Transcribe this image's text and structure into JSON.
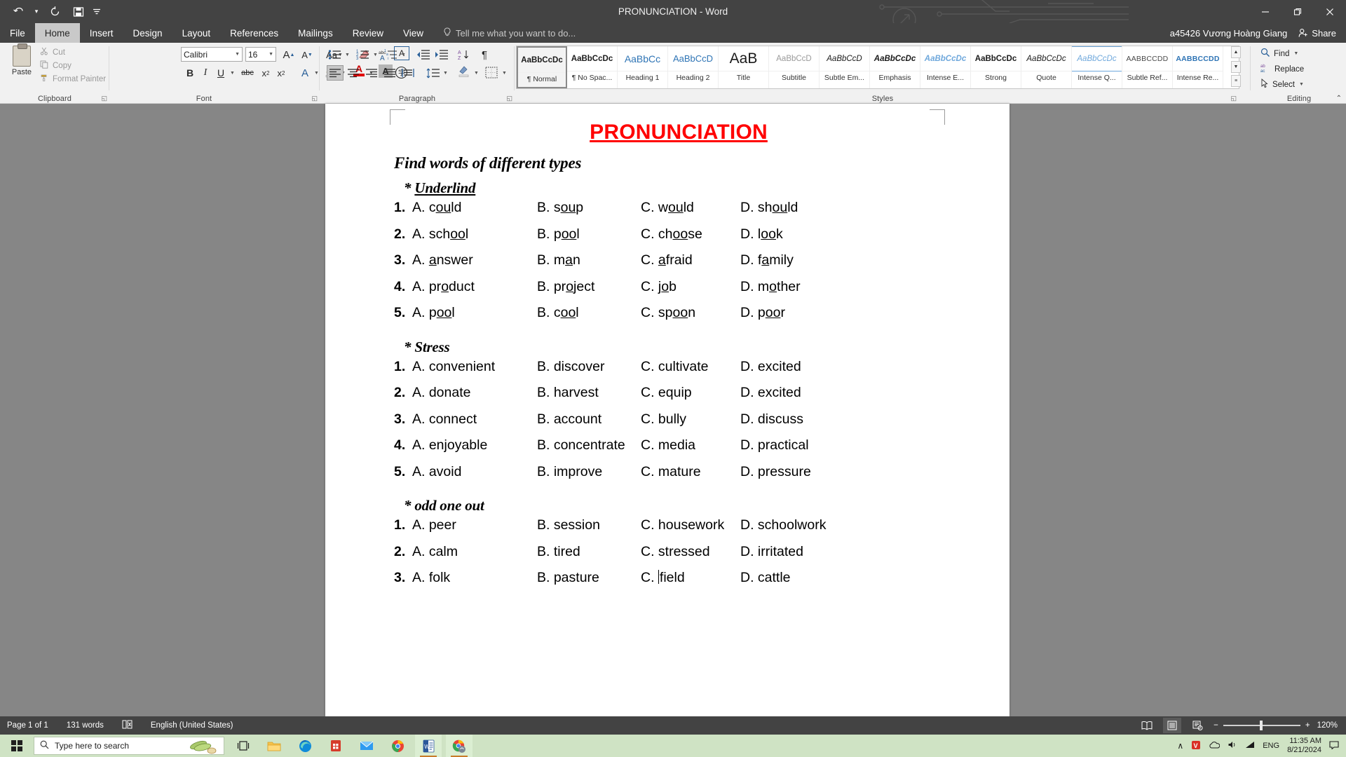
{
  "titlebar": {
    "document_title": "PRONUNCIATION - Word",
    "qat": [
      {
        "name": "undo",
        "glyph": "↶"
      },
      {
        "name": "undo-dropdown",
        "glyph": "▾"
      },
      {
        "name": "redo",
        "glyph": "↻"
      },
      {
        "name": "save",
        "glyph": "὚b"
      },
      {
        "name": "customize-qat",
        "glyph": "≔"
      }
    ],
    "window_buttons": {
      "minimize": "─",
      "restore": "❐",
      "close": "✕"
    }
  },
  "ribbon_tabs": {
    "tabs": [
      "File",
      "Home",
      "Insert",
      "Design",
      "Layout",
      "References",
      "Mailings",
      "Review",
      "View"
    ],
    "active": "Home",
    "tell_me": "Tell me what you want to do...",
    "account_name": "a45426 Vương Hoàng Giang",
    "share_label": "Share"
  },
  "ribbon": {
    "groups": [
      {
        "name": "Clipboard",
        "label": "Clipboard"
      },
      {
        "name": "Font",
        "label": "Font"
      },
      {
        "name": "Paragraph",
        "label": "Paragraph"
      },
      {
        "name": "Styles",
        "label": "Styles"
      },
      {
        "name": "Editing",
        "label": "Editing"
      }
    ],
    "clipboard": {
      "paste_label": "Paste",
      "items": [
        {
          "label": "Cut",
          "icon": "scissors-icon",
          "glyph": "✂"
        },
        {
          "label": "Copy",
          "icon": "copy-icon",
          "glyph": "⧉"
        },
        {
          "label": "Format Painter",
          "icon": "format-painter-icon",
          "glyph": "✒"
        }
      ]
    },
    "font": {
      "font_name": "Calibri",
      "font_size": "16",
      "buttons": [
        {
          "name": "grow-font",
          "glyph": "A"
        },
        {
          "name": "shrink-font",
          "glyph": "A"
        },
        {
          "name": "change-case",
          "glyph": "Aa"
        },
        {
          "name": "clear-formatting",
          "glyph": "⌫"
        },
        {
          "name": "phonetic-guide",
          "glyph": "abc"
        },
        {
          "name": "character-border",
          "glyph": "A"
        },
        {
          "name": "bold",
          "glyph": "B"
        },
        {
          "name": "italic",
          "glyph": "I"
        },
        {
          "name": "underline",
          "glyph": "U"
        },
        {
          "name": "strikethrough",
          "glyph": "abc"
        },
        {
          "name": "subscript",
          "glyph": "x₂"
        },
        {
          "name": "superscript",
          "glyph": "x²"
        },
        {
          "name": "text-effects",
          "glyph": "A"
        },
        {
          "name": "text-highlight-color",
          "glyph": "✐"
        },
        {
          "name": "font-color",
          "glyph": "A"
        },
        {
          "name": "character-shading",
          "glyph": "A"
        },
        {
          "name": "enclose-characters",
          "glyph": "Ⓢ"
        }
      ]
    },
    "paragraph": {
      "buttons": [
        {
          "name": "bullets",
          "glyph": "≣"
        },
        {
          "name": "numbering",
          "glyph": "≣"
        },
        {
          "name": "multilevel-list",
          "glyph": "≣"
        },
        {
          "name": "decrease-indent",
          "glyph": "⇤"
        },
        {
          "name": "increase-indent",
          "glyph": "⇥"
        },
        {
          "name": "sort",
          "glyph": "↓"
        },
        {
          "name": "show-formatting-marks",
          "glyph": "¶"
        },
        {
          "name": "align-left",
          "glyph": "≡"
        },
        {
          "name": "align-center",
          "glyph": "≡"
        },
        {
          "name": "align-right",
          "glyph": "≡"
        },
        {
          "name": "justify",
          "glyph": "≡"
        },
        {
          "name": "distributed",
          "glyph": "≡"
        },
        {
          "name": "line-spacing",
          "glyph": "↕"
        },
        {
          "name": "shading",
          "glyph": "◧"
        },
        {
          "name": "borders",
          "glyph": "▦"
        }
      ]
    },
    "styles": {
      "gallery": [
        {
          "preview": "AaBbCcDc",
          "name": "¶ Normal",
          "style": "normal",
          "selected": true
        },
        {
          "preview": "AaBbCcDc",
          "name": "¶ No Spac...",
          "style": "nospacing",
          "selected": false
        },
        {
          "preview": "AaBbCc",
          "name": "Heading 1",
          "style": "heading1",
          "selected": false
        },
        {
          "preview": "AaBbCcD",
          "name": "Heading 2",
          "style": "heading2",
          "selected": false
        },
        {
          "preview": "AaB",
          "name": "Title",
          "style": "title",
          "selected": false
        },
        {
          "preview": "AaBbCcD",
          "name": "Subtitle",
          "style": "subtitle",
          "selected": false
        },
        {
          "preview": "AaBbCcD",
          "name": "Subtle Em...",
          "style": "subtleem",
          "selected": false
        },
        {
          "preview": "AaBbCcDc",
          "name": "Emphasis",
          "style": "emphasis",
          "selected": false
        },
        {
          "preview": "AaBbCcDc",
          "name": "Intense E...",
          "style": "intenseem",
          "selected": false
        },
        {
          "preview": "AaBbCcDc",
          "name": "Strong",
          "style": "strong",
          "selected": false
        },
        {
          "preview": "AaBbCcDc",
          "name": "Quote",
          "style": "quote",
          "selected": false
        },
        {
          "preview": "AaBbCcDc",
          "name": "Intense Q...",
          "style": "intensequote",
          "selected": false
        },
        {
          "preview": "AABBCCDD",
          "name": "Subtle Ref...",
          "style": "subtleref",
          "selected": false
        },
        {
          "preview": "AABBCCDD",
          "name": "Intense Re...",
          "style": "intenseref",
          "selected": false
        }
      ]
    },
    "editing": {
      "items": [
        {
          "label": "Find",
          "icon": "magnifier-icon",
          "glyph": "ὐd",
          "has_caret": true
        },
        {
          "label": "Replace",
          "icon": "replace-icon",
          "glyph": "ab",
          "has_caret": false
        },
        {
          "label": "Select",
          "icon": "cursor-icon",
          "glyph": "➤",
          "has_caret": true
        }
      ]
    }
  },
  "document": {
    "title": "PRONUNCIATION",
    "instruction": "Find words of different types",
    "sections": [
      {
        "heading": "* Underlind",
        "heading_star": "*",
        "heading_text": "Underlind",
        "underlined_heading": true,
        "questions": [
          {
            "num": "1.",
            "a": "A. could",
            "b": "B. soup",
            "c": "C. would",
            "d": "D. should"
          },
          {
            "num": "2.",
            "a": "A. school",
            "b": "B. pool",
            "c": "C. choose",
            "d": "D. look"
          },
          {
            "num": "3.",
            "a": "A. answer",
            "b": "B. man",
            "c": "C. afraid",
            "d": "D. family"
          },
          {
            "num": "4.",
            "a": "A. product",
            "b": "B. project",
            "c": "C. job",
            "d": "D. mother"
          },
          {
            "num": "5.",
            "a": "A. pool",
            "b": "B. cool",
            "c": "C. spoon",
            "d": "D. poor"
          }
        ]
      },
      {
        "heading": "* Stress",
        "heading_star": "*",
        "heading_text": "Stress",
        "underlined_heading": false,
        "questions": [
          {
            "num": "1.",
            "a": "A. convenient",
            "b": "B. discover",
            "c": "C. cultivate",
            "d": "D. excited"
          },
          {
            "num": "2.",
            "a": "A. donate",
            "b": "B. harvest",
            "c": "C. equip",
            "d": "D. excited"
          },
          {
            "num": "3.",
            "a": "A. connect",
            "b": "B. account",
            "c": "C. bully",
            "d": "D. discuss"
          },
          {
            "num": "4.",
            "a": "A. enjoyable",
            "b": "B. concentrate",
            "c": "C. media",
            "d": "D. practical"
          },
          {
            "num": "5.",
            "a": "A. avoid",
            "b": "B. improve",
            "c": "C. mature",
            "d": "D. pressure"
          }
        ]
      },
      {
        "heading": "* odd one out",
        "heading_star": "*",
        "heading_text": "odd one out",
        "underlined_heading": false,
        "questions": [
          {
            "num": "1.",
            "a": "A. peer",
            "b": "B. session",
            "c": "C. housework",
            "d": "D. schoolwork"
          },
          {
            "num": "2.",
            "a": "A. calm",
            "b": "B. tired",
            "c": "C. stressed",
            "d": "D. irritated"
          },
          {
            "num": "3.",
            "a": "A. folk",
            "b": "B. pasture",
            "c": "C. field",
            "d": "D. cattle",
            "caret_in": "c"
          }
        ]
      }
    ],
    "underline_map": {
      "1": [
        [
          "c",
          "ou",
          "ld"
        ],
        [
          "s",
          "ou",
          "p"
        ],
        [
          "w",
          "ou",
          "ld"
        ],
        [
          "sh",
          "ou",
          "ld"
        ]
      ],
      "2": [
        [
          "sch",
          "oo",
          "l"
        ],
        [
          "p",
          "oo",
          "l"
        ],
        [
          "ch",
          "oo",
          "se"
        ],
        [
          "l",
          "oo",
          "k"
        ]
      ],
      "3": [
        [
          "",
          "a",
          "nswer"
        ],
        [
          "m",
          "a",
          "n"
        ],
        [
          "",
          "a",
          "fraid"
        ],
        [
          "f",
          "a",
          "mily"
        ]
      ],
      "4": [
        [
          "pr",
          "o",
          "duct"
        ],
        [
          "pr",
          "o",
          "ject"
        ],
        [
          "j",
          "o",
          "b"
        ],
        [
          "m",
          "o",
          "ther"
        ]
      ],
      "5": [
        [
          "p",
          "oo",
          "l"
        ],
        [
          "c",
          "oo",
          "l"
        ],
        [
          "sp",
          "oo",
          "n"
        ],
        [
          "p",
          "oo",
          "r"
        ]
      ]
    }
  },
  "statusbar": {
    "page": "Page 1 of 1",
    "words": "131 words",
    "proofing_icon": "proofing-errors-icon",
    "language": "English (United States)",
    "views": [
      {
        "name": "read-mode",
        "glyph": "Ὅ6",
        "active": false
      },
      {
        "name": "print-layout",
        "glyph": "▤",
        "active": true
      },
      {
        "name": "web-layout",
        "glyph": "▧",
        "active": false
      }
    ],
    "zoom_out": "−",
    "zoom_in": "+",
    "zoom_level": "120%"
  },
  "taskbar": {
    "search_placeholder": "Type here to search",
    "apps": [
      {
        "name": "task-view",
        "glyph": "❐",
        "active": false
      },
      {
        "name": "file-explorer",
        "glyph": "Ὄ1",
        "active": false
      },
      {
        "name": "microsoft-edge",
        "glyph": "◔",
        "active": false
      },
      {
        "name": "microsoft-store",
        "glyph": "Ὤd",
        "active": false
      },
      {
        "name": "mail",
        "glyph": "✉",
        "active": false
      },
      {
        "name": "google-chrome",
        "glyph": "◎",
        "active": false
      },
      {
        "name": "microsoft-word",
        "glyph": "W",
        "active": true
      },
      {
        "name": "google-chrome-second",
        "glyph": "◎",
        "active": true
      }
    ],
    "tray": {
      "show_hidden": "∧",
      "icons": [
        "V",
        "Ὓ6",
        "ὐa",
        "὚7"
      ],
      "language": "ENG",
      "time": "11:35 AM",
      "date": "8/21/2024",
      "action_center": "὚8"
    }
  }
}
